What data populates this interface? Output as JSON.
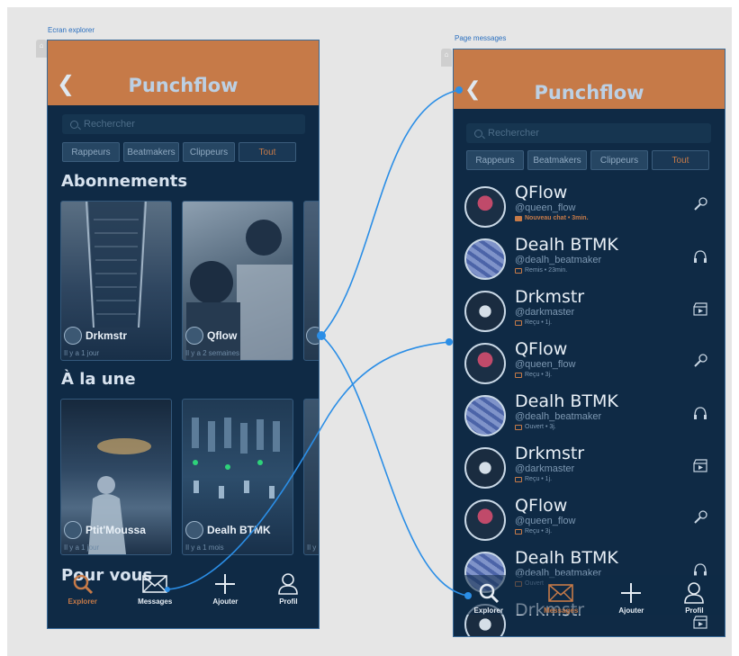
{
  "frames": {
    "left_label": "Ecran explorer",
    "right_label": "Page messages"
  },
  "app": {
    "title": "Punchflow",
    "back_icon": "chevron-left-icon"
  },
  "search": {
    "placeholder": "Rechercher"
  },
  "filters": [
    "Rappeurs",
    "Beatmakers",
    "Clippeurs",
    "Tout"
  ],
  "active_filter": "Tout",
  "explorer": {
    "sections": {
      "subscriptions": "Abonnements",
      "featured": "À la une",
      "for_you": "Pour vous"
    },
    "subscriptions": [
      {
        "name": "Drkmstr",
        "time": "Il y a 1 jour"
      },
      {
        "name": "Qflow",
        "time": "Il y a 2 semaines"
      }
    ],
    "featured": [
      {
        "name": "Ptit'Moussa",
        "time": "Il y a 1 jour"
      },
      {
        "name": "Dealh BTMK",
        "time": "Il y a 1 mois"
      },
      {
        "name": "",
        "time": "Il y"
      }
    ]
  },
  "nav": {
    "explorer": "Explorer",
    "messages": "Messages",
    "add": "Ajouter",
    "profile": "Profil"
  },
  "messages": [
    {
      "name": "QFlow",
      "handle": "@queen_flow",
      "status": "Nouveau chat • 3min.",
      "role_icon": "microphone-icon",
      "new": true
    },
    {
      "name": "Dealh BTMK",
      "handle": "@dealh_beatmaker",
      "status": "Remis • 23min.",
      "role_icon": "headphones-icon",
      "new": false
    },
    {
      "name": "Drkmstr",
      "handle": "@darkmaster",
      "status": "Reçu • 1j.",
      "role_icon": "clapperboard-icon",
      "new": false
    },
    {
      "name": "QFlow",
      "handle": "@queen_flow",
      "status": "Reçu • 3j.",
      "role_icon": "microphone-icon",
      "new": false
    },
    {
      "name": "Dealh BTMK",
      "handle": "@dealh_beatmaker",
      "status": "Ouvert • 3j.",
      "role_icon": "headphones-icon",
      "new": false
    },
    {
      "name": "Drkmstr",
      "handle": "@darkmaster",
      "status": "Reçu • 1j.",
      "role_icon": "clapperboard-icon",
      "new": false
    },
    {
      "name": "QFlow",
      "handle": "@queen_flow",
      "status": "Reçu • 3j.",
      "role_icon": "microphone-icon",
      "new": false
    },
    {
      "name": "Dealh BTMK",
      "handle": "@dealh_beatmaker",
      "status": "Ouvert",
      "role_icon": "headphones-icon",
      "new": false
    },
    {
      "name": "Drkmstr",
      "handle": "",
      "status": "",
      "role_icon": "clapperboard-icon",
      "new": false
    }
  ],
  "colors": {
    "accent": "#c67a48",
    "background": "#0f2a45",
    "link": "#2b8ee6"
  }
}
